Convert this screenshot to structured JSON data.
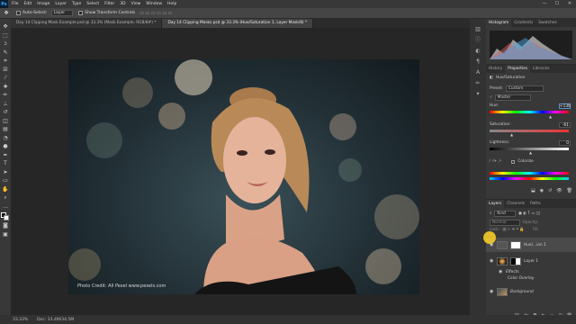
{
  "app": {
    "logo": "Ps"
  },
  "menu": [
    "File",
    "Edit",
    "Image",
    "Layer",
    "Type",
    "Select",
    "Filter",
    "3D",
    "View",
    "Window",
    "Help"
  ],
  "window_controls": [
    "—",
    "☐",
    "✕"
  ],
  "options_bar": {
    "tool_icon": "move-tool-icon",
    "auto_select_label": "Auto-Select:",
    "auto_select_value": "Layer",
    "transform_label": "Show Transform Controls"
  },
  "tabs": [
    {
      "label": "Day 14 Clipping Mask Example.psd @ 33.3% (Mask Example, RGB/8#) *",
      "active": false
    },
    {
      "label": "Day 14 Clipping Masks.psd @ 33.3% (Hue/Saturation 1, Layer Mask/8) *",
      "active": true
    }
  ],
  "photo": {
    "credit": "Photo Credit: All Pexel   www.pexels.com"
  },
  "status": {
    "zoom": "33.33%",
    "doc": "Doc: 33.4M/34.5M"
  },
  "histogram_panel": {
    "tabs": [
      "Histogram",
      "Gradients",
      "Swatches"
    ]
  },
  "properties_panel": {
    "tabs": [
      "History",
      "Properties",
      "Libraries"
    ],
    "title": "Hue/Saturation",
    "preset_label": "Preset:",
    "preset_value": "Custom",
    "channel_value": "Master",
    "hue_label": "Hue:",
    "hue_value": "+136",
    "saturation_label": "Saturation:",
    "saturation_value": "-61",
    "lightness_label": "Lightness:",
    "lightness_value": "0",
    "colorize_label": "Colorize"
  },
  "layers_panel": {
    "tabs": [
      "Layers",
      "Channels",
      "Paths"
    ],
    "kind_label": "Kind",
    "blend_label": "Normal",
    "opacity_label": "Opacity:",
    "lock_label": "Lock:",
    "fill_label": "Fill:",
    "layers": [
      {
        "name": "Hue/...ion 1"
      },
      {
        "name": "Layer 1"
      },
      {
        "name": "Effects"
      },
      {
        "name": "Color Overlay"
      },
      {
        "name": "Background"
      }
    ]
  }
}
